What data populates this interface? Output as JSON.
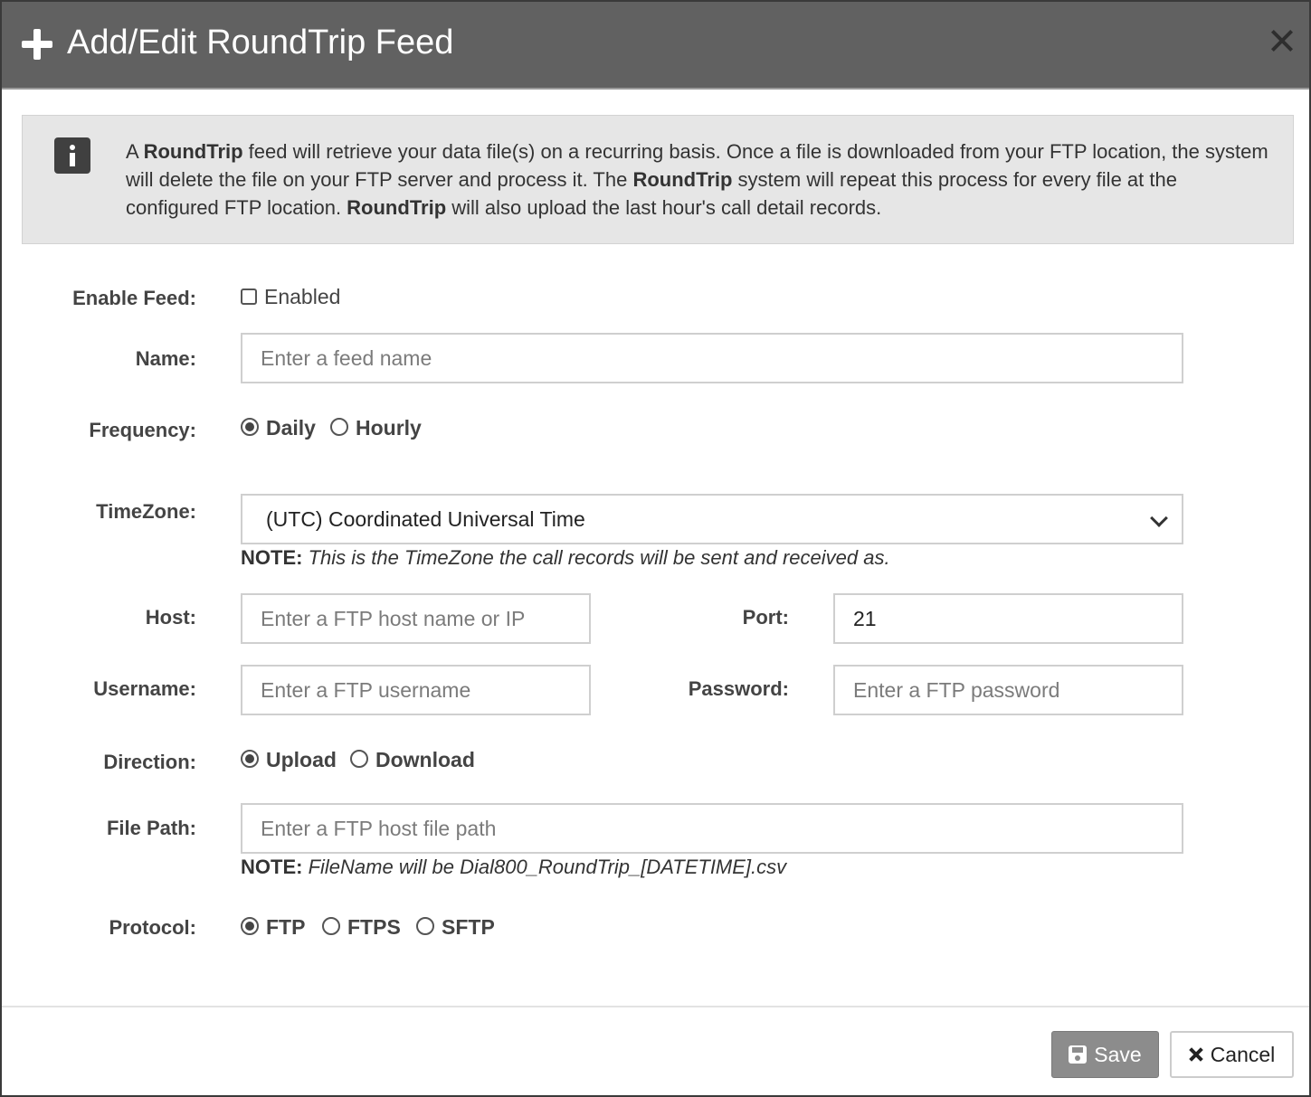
{
  "dialog": {
    "title": "Add/Edit RoundTrip Feed",
    "icon": "plus-icon",
    "close_icon": "close-icon"
  },
  "info": {
    "icon": "info-icon",
    "p1": "A ",
    "b1": "RoundTrip",
    "p2": " feed will retrieve your data file(s) on a recurring basis. Once a file is downloaded from your FTP location, the system will delete the file on your FTP server and process it. The ",
    "b2": "RoundTrip",
    "p3": " system will repeat this process for every file at the configured FTP location. ",
    "b3": "RoundTrip",
    "p4": " will also upload the last hour's call detail records."
  },
  "form": {
    "enable_feed": {
      "label": "Enable Feed:",
      "option": "Enabled",
      "checked": false
    },
    "name": {
      "label": "Name:",
      "value": "",
      "placeholder": "Enter a feed name"
    },
    "frequency": {
      "label": "Frequency:",
      "options": [
        "Daily",
        "Hourly"
      ],
      "selected": "Daily"
    },
    "timezone": {
      "label": "TimeZone:",
      "selected": "(UTC) Coordinated Universal Time",
      "note_label": "NOTE:",
      "note": "This is the TimeZone the call records will be sent and received as."
    },
    "host": {
      "label": "Host:",
      "value": "",
      "placeholder": "Enter a FTP host name or IP"
    },
    "port": {
      "label": "Port:",
      "value": "21"
    },
    "username": {
      "label": "Username:",
      "value": "",
      "placeholder": "Enter a FTP username"
    },
    "password": {
      "label": "Password:",
      "value": "",
      "placeholder": "Enter a FTP password"
    },
    "direction": {
      "label": "Direction:",
      "options": [
        "Upload",
        "Download"
      ],
      "selected": "Upload"
    },
    "file_path": {
      "label": "File Path:",
      "value": "",
      "placeholder": "Enter a FTP host file path",
      "note_label": "NOTE:",
      "note": "FileName will be Dial800_RoundTrip_[DATETIME].csv"
    },
    "protocol": {
      "label": "Protocol:",
      "options": [
        "FTP",
        "FTPS",
        "SFTP"
      ],
      "selected": "FTP"
    }
  },
  "footer": {
    "save_label": "Save",
    "save_icon": "floppy-disk-icon",
    "cancel_label": "Cancel",
    "cancel_icon": "x-icon"
  }
}
